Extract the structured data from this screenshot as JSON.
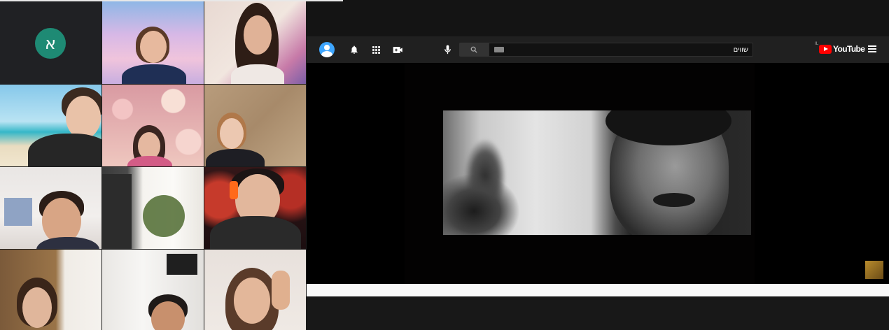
{
  "gallery": {
    "tiles": [
      {
        "name": "participant-1",
        "initial": "א",
        "avatar_color": "#1e8a74"
      },
      {
        "name": "participant-2"
      },
      {
        "name": "participant-3"
      },
      {
        "name": "participant-4"
      },
      {
        "name": "participant-5"
      },
      {
        "name": "participant-6"
      },
      {
        "name": "participant-7"
      },
      {
        "name": "participant-8"
      },
      {
        "name": "participant-9"
      },
      {
        "name": "participant-10"
      },
      {
        "name": "participant-11"
      },
      {
        "name": "participant-12"
      }
    ]
  },
  "youtube": {
    "logo_text": "YouTube",
    "region": "IL",
    "search_query": "שווים",
    "icons": [
      "account-icon",
      "notifications-icon",
      "apps-icon",
      "create-video-icon",
      "microphone-icon",
      "search-icon",
      "keyboard-icon",
      "menu-icon"
    ],
    "colors": {
      "brand": "#ff0000",
      "header": "#202020",
      "account": "#3ea6ff"
    }
  }
}
